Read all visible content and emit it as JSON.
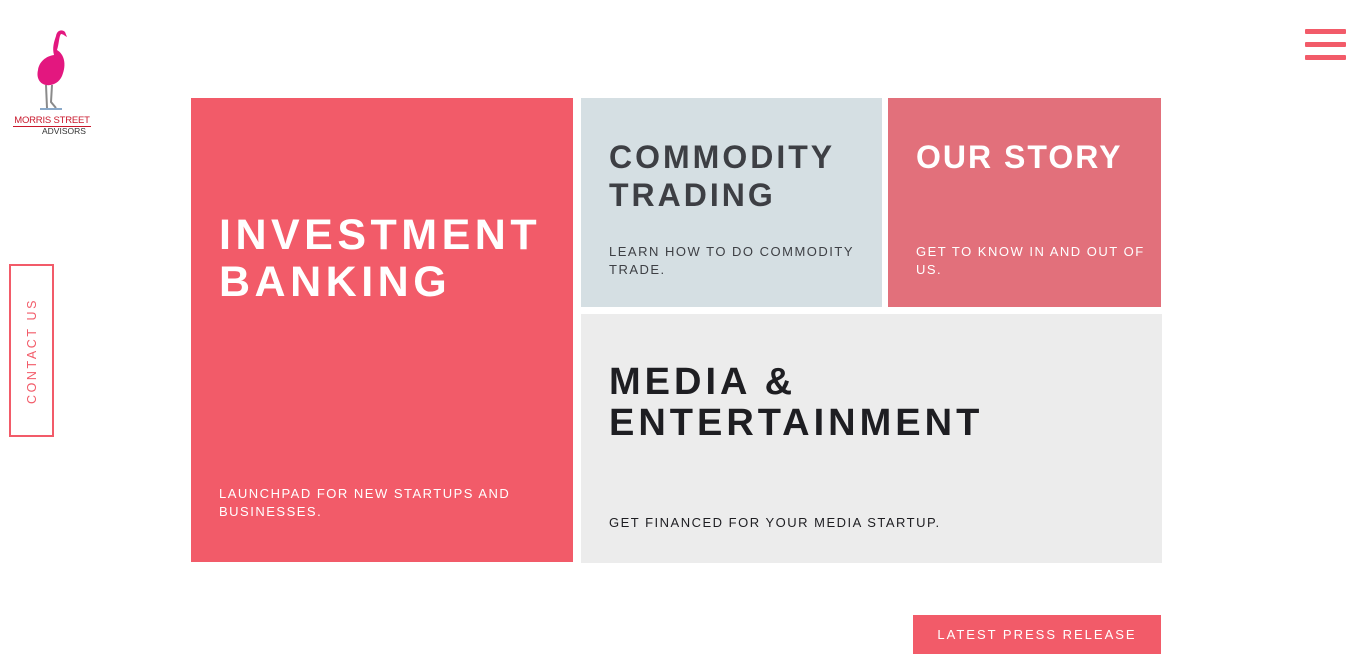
{
  "logo": {
    "line1": "MORRIS STREET",
    "line2": "ADVISORS",
    "icon": "flamingo-icon",
    "brand_color": "#e3177f"
  },
  "menu": {
    "icon": "hamburger-menu-icon"
  },
  "contact": {
    "label": "CONTACT US"
  },
  "tiles": {
    "investment": {
      "title_1": "INVESTMENT",
      "title_2": "BANKING",
      "subtitle": "LAUNCHPAD FOR NEW STARTUPS AND BUSINESSES."
    },
    "commodity": {
      "title_1": "COMMODITY",
      "title_2": "TRADING",
      "subtitle": "LEARN HOW TO DO COMMODITY TRADE."
    },
    "story": {
      "title": "OUR STORY",
      "subtitle": "GET TO KNOW IN AND OUT OF US."
    },
    "media": {
      "title_1": "MEDIA &",
      "title_2": "ENTERTAINMENT",
      "subtitle": "GET FINANCED FOR YOUR MEDIA STARTUP."
    }
  },
  "press_button": {
    "label": "LATEST PRESS RELEASE"
  },
  "colors": {
    "accent": "#f25b69",
    "commodity_bg": "#d5dfe3",
    "story_bg": "#e2707b",
    "media_bg": "#ececec"
  }
}
